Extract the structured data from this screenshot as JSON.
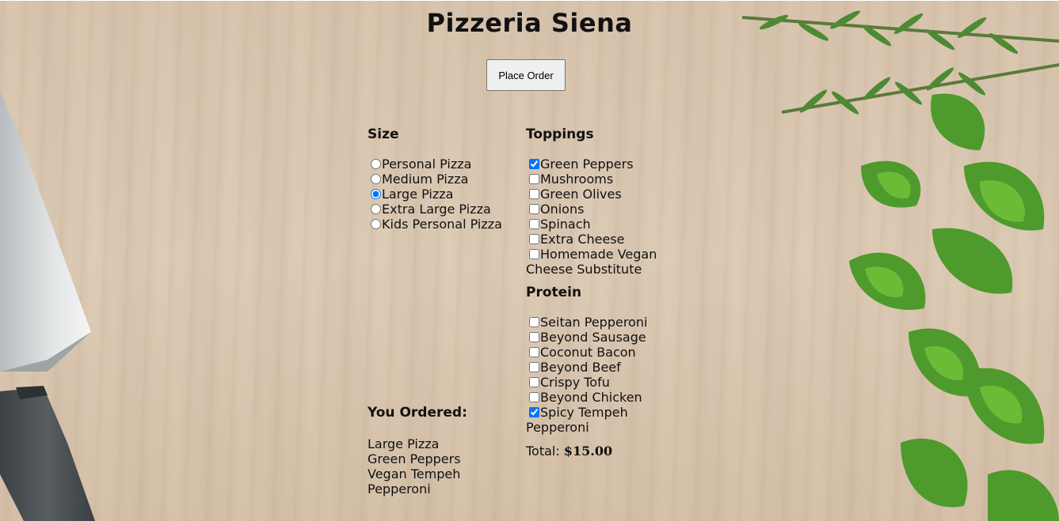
{
  "app": {
    "title": "Pizzeria Siena"
  },
  "actions": {
    "place_order_label": "Place Order"
  },
  "size": {
    "heading": "Size",
    "options": [
      {
        "label": "Personal Pizza",
        "selected": false
      },
      {
        "label": "Medium Pizza",
        "selected": false
      },
      {
        "label": "Large Pizza",
        "selected": true
      },
      {
        "label": "Extra Large Pizza",
        "selected": false
      },
      {
        "label": "Kids Personal Pizza",
        "selected": false
      }
    ]
  },
  "toppings": {
    "heading": "Toppings",
    "options": [
      {
        "label": "Green Peppers",
        "checked": true
      },
      {
        "label": "Mushrooms",
        "checked": false
      },
      {
        "label": "Green Olives",
        "checked": false
      },
      {
        "label": "Onions",
        "checked": false
      },
      {
        "label": "Spinach",
        "checked": false
      },
      {
        "label": "Extra Cheese",
        "checked": false
      },
      {
        "label": "Homemade Vegan Cheese Substitute",
        "checked": false
      }
    ]
  },
  "protein": {
    "heading": "Protein",
    "options": [
      {
        "label": "Seitan Pepperoni",
        "checked": false
      },
      {
        "label": "Beyond Sausage",
        "checked": false
      },
      {
        "label": "Coconut Bacon",
        "checked": false
      },
      {
        "label": "Beyond Beef",
        "checked": false
      },
      {
        "label": "Crispy Tofu",
        "checked": false
      },
      {
        "label": "Beyond Chicken",
        "checked": false
      },
      {
        "label": "Spicy Tempeh Pepperoni",
        "checked": true
      }
    ]
  },
  "summary": {
    "heading": "You Ordered:",
    "lines": [
      "Large Pizza",
      "Green Peppers",
      "Vegan Tempeh",
      "Pepperoni"
    ],
    "total_label": "Total:",
    "total_value": "$15.00"
  }
}
